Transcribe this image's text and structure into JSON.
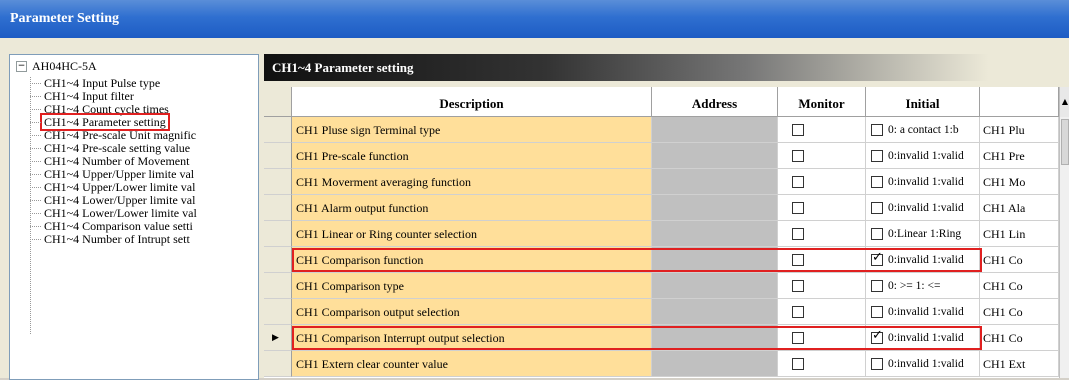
{
  "window": {
    "title": "Parameter Setting"
  },
  "tree": {
    "root_label": "AH04HC-5A",
    "expander_glyph": "−",
    "items": [
      {
        "label": "CH1~4 Input Pulse type"
      },
      {
        "label": "CH1~4 Input filter"
      },
      {
        "label": "CH1~4 Count cycle times"
      },
      {
        "label": "CH1~4 Parameter setting"
      },
      {
        "label": "CH1~4 Pre-scale Unit magnific"
      },
      {
        "label": "CH1~4 Pre-scale setting value"
      },
      {
        "label": "CH1~4 Number of Movement"
      },
      {
        "label": "CH1~4 Upper/Upper limite val"
      },
      {
        "label": "CH1~4 Upper/Lower limite val"
      },
      {
        "label": "CH1~4 Lower/Upper limite val"
      },
      {
        "label": "CH1~4 Lower/Lower limite val"
      },
      {
        "label": "CH1~4 Comparison value setti"
      },
      {
        "label": "CH1~4 Number of Intrupt sett"
      }
    ]
  },
  "panel": {
    "title": "CH1~4 Parameter setting"
  },
  "table": {
    "headers": {
      "description": "Description",
      "address": "Address",
      "monitor": "Monitor",
      "initial": "Initial"
    },
    "current_row_glyph": "▶",
    "scroll_up_glyph": "▲",
    "rows": [
      {
        "description": "CH1 Pluse sign Terminal type",
        "init_text": "0: a contact  1:b",
        "extra": "CH1 Plu",
        "init_checked": false
      },
      {
        "description": "CH1 Pre-scale function",
        "init_text": "0:invalid 1:valid",
        "extra": "CH1 Pre",
        "init_checked": false
      },
      {
        "description": "CH1 Moverment averaging function",
        "init_text": "0:invalid 1:valid",
        "extra": "CH1 Mo",
        "init_checked": false
      },
      {
        "description": "CH1 Alarm output function",
        "init_text": "0:invalid 1:valid",
        "extra": "CH1 Ala",
        "init_checked": false
      },
      {
        "description": "CH1 Linear or Ring counter selection",
        "init_text": "0:Linear 1:Ring",
        "extra": "CH1 Lin",
        "init_checked": false
      },
      {
        "description": "CH1 Comparison function",
        "init_text": "0:invalid 1:valid",
        "extra": "CH1 Co",
        "init_checked": true
      },
      {
        "description": "CH1 Comparison type",
        "init_text": "0: >= 1: <=",
        "extra": "CH1 Co",
        "init_checked": false
      },
      {
        "description": "CH1 Comparison output selection",
        "init_text": "0:invalid 1:valid",
        "extra": "CH1 Co",
        "init_checked": false
      },
      {
        "description": "CH1 Comparison Interrupt output selection",
        "init_text": "0:invalid 1:valid",
        "extra": "CH1 Co",
        "init_checked": true
      },
      {
        "description": "CH1 Extern clear counter value",
        "init_text": "0:invalid 1:valid",
        "extra": "CH1 Ext",
        "init_checked": false
      }
    ]
  }
}
